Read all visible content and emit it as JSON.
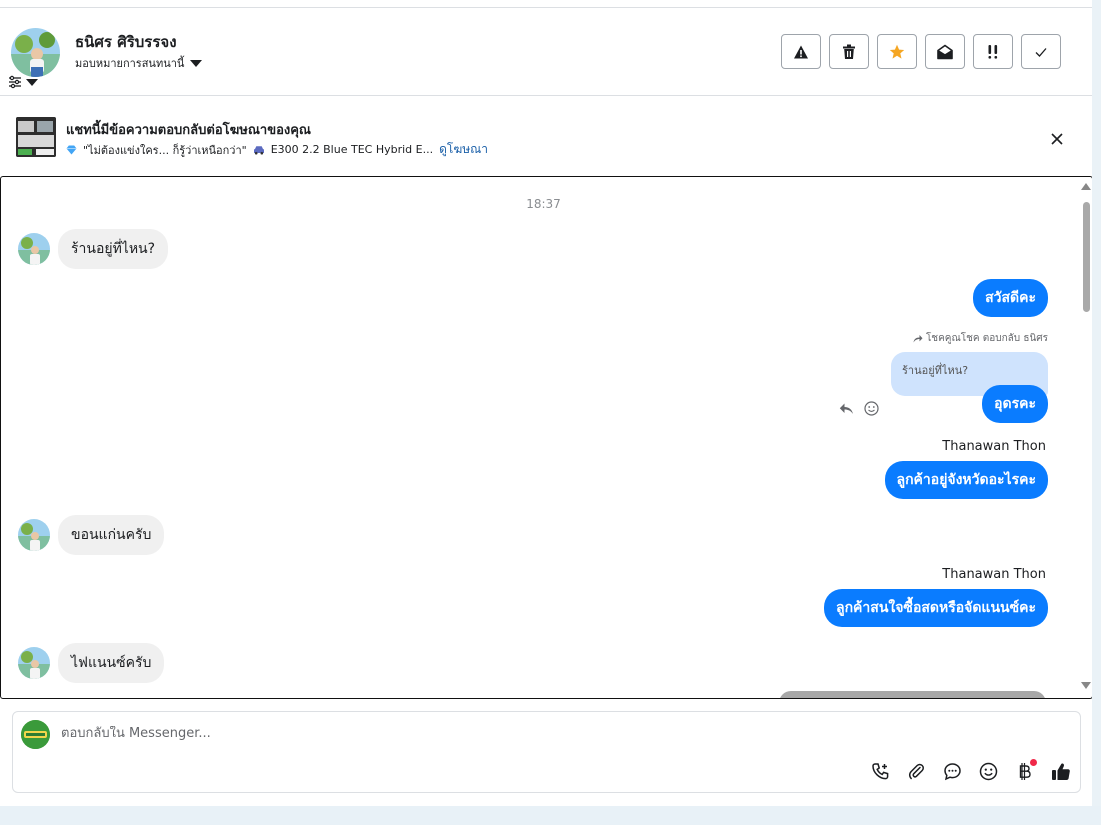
{
  "header": {
    "user_name": "ธนิศร ศิริบรรจง",
    "assign_label": "มอบหมายการสนทนานี้",
    "actions": [
      {
        "name": "report-button",
        "icon": "warning-icon"
      },
      {
        "name": "delete-button",
        "icon": "trash-icon"
      },
      {
        "name": "star-button",
        "icon": "star-icon"
      },
      {
        "name": "mark-unread-button",
        "icon": "envelope-open-icon"
      },
      {
        "name": "follow-up-button",
        "icon": "double-exclamation-icon"
      },
      {
        "name": "done-button",
        "icon": "check-icon"
      }
    ]
  },
  "adbar": {
    "title": "แชทนี้มีข้อความตอบกลับต่อโฆษณาของคุณ",
    "ad_text": "\"ไม่ต้องแข่งใคร... ก็รู้ว่าเหนือกว่า\"",
    "ad_model": "E300 2.2 Blue TEC Hybrid E...",
    "view_ad": "ดูโฆษณา"
  },
  "chat": {
    "timestamp": "18:37",
    "messages": {
      "in1": "ร้านอยู่ที่ไหน?",
      "out1": "สวัสดีคะ",
      "reply_meta": "โชคคูณโชค ตอบกลับ ธนิศร",
      "quoted": "ร้านอยู่ที่ไหน?",
      "out2": "อุดรคะ",
      "sender1": "Thanawan Thon",
      "out3": "ลูกค้าอยู่จังหวัดอะไรคะ",
      "in2": "ขอนแก่นครับ",
      "sender2": "Thanawan Thon",
      "out4": "ลูกค้าสนใจซื้อสดหรือจัดแนนซ์คะ",
      "in3": "ไฟแนนซ์ครับ"
    }
  },
  "composer": {
    "placeholder": "ตอบกลับใน Messenger..."
  },
  "colors": {
    "accent": "#0a7cff",
    "star": "#f5a623",
    "notification": "#f02849"
  }
}
